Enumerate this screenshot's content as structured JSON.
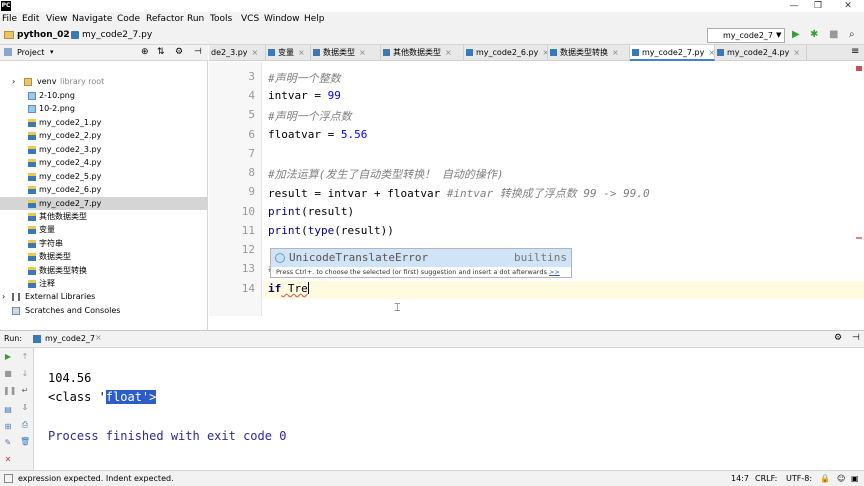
{
  "window": {
    "logo": "PC",
    "title_btns": [
      "—",
      "❐",
      "✕"
    ]
  },
  "menu": [
    "File",
    "Edit",
    "View",
    "Navigate",
    "Code",
    "Refactor",
    "Run",
    "Tools",
    "VCS",
    "Window",
    "Help"
  ],
  "breadcrumb": {
    "project": "python_02",
    "file": "my_code2_7.py"
  },
  "run_config": "my_code2_7",
  "project_panel": {
    "title": "Project"
  },
  "tree": [
    {
      "label": "venv",
      "suffix": "library root",
      "type": "folder",
      "depth": 0,
      "expand": "›"
    },
    {
      "label": "2-10.png",
      "type": "image",
      "depth": 1
    },
    {
      "label": "10-2.png",
      "type": "image",
      "depth": 1
    },
    {
      "label": "my_code2_1.py",
      "type": "py",
      "depth": 1
    },
    {
      "label": "my_code2_2.py",
      "type": "py",
      "depth": 1
    },
    {
      "label": "my_code2_3.py",
      "type": "py",
      "depth": 1
    },
    {
      "label": "my_code2_4.py",
      "type": "py",
      "depth": 1
    },
    {
      "label": "my_code2_5.py",
      "type": "py",
      "depth": 1
    },
    {
      "label": "my_code2_6.py",
      "type": "py",
      "depth": 1
    },
    {
      "label": "my_code2_7.py",
      "type": "py",
      "depth": 1,
      "selected": true
    },
    {
      "label": "其他数据类型",
      "type": "py",
      "depth": 1
    },
    {
      "label": "变量",
      "type": "py",
      "depth": 1
    },
    {
      "label": "字符串",
      "type": "py",
      "depth": 1
    },
    {
      "label": "数据类型",
      "type": "py",
      "depth": 1
    },
    {
      "label": "数据类型转换",
      "type": "py",
      "depth": 1
    },
    {
      "label": "注释",
      "type": "py",
      "depth": 1
    },
    {
      "label": "External Libraries",
      "type": "lib",
      "depth": 0,
      "expand": "›"
    },
    {
      "label": "Scratches and Consoles",
      "type": "scratch",
      "depth": 0
    }
  ],
  "tabs": [
    {
      "label": "de2_3.py",
      "active": false
    },
    {
      "label": "变量",
      "active": false
    },
    {
      "label": "数据类型",
      "active": false
    },
    {
      "label": "其他数据类型",
      "active": false
    },
    {
      "label": "my_code2_6.py",
      "active": false
    },
    {
      "label": "数据类型转换",
      "active": false
    },
    {
      "label": "my_code2_7.py",
      "active": true
    },
    {
      "label": "my_code2_4.py",
      "active": false
    }
  ],
  "line_numbers": [
    "3",
    "4",
    "5",
    "6",
    "7",
    "8",
    "9",
    "10",
    "11",
    "12",
    "13",
    "14"
  ],
  "code": {
    "l3": "#声明一个整数",
    "l4a": "intvar",
    "l4b": " = ",
    "l4c": "99",
    "l5": "#声明一个浮点数",
    "l6a": "floatvar",
    "l6b": " = ",
    "l6c": "5.56",
    "l8": "#加法运算(发生了自动类型转换！ 自动的操作)",
    "l9a": "result = intvar + floatvar ",
    "l9b": "#intvar 转换成了浮点数 99 -> 99.0",
    "l10a": "print",
    "l10b": "(result)",
    "l11a": "print",
    "l11b": "(",
    "l11c": "type",
    "l11d": "(result))",
    "l13": "#",
    "l14a": "if",
    "l14b": " Tre"
  },
  "completion": {
    "name": "UnicodeTranslateError",
    "module": "builtins",
    "hint": "Press Ctrl+. to choose the selected (or first) suggestion and insert a dot afterwards",
    "hint_link": ">>"
  },
  "run_panel": {
    "label": "Run:",
    "tab": "my_code2_7"
  },
  "console": {
    "line1": "104.56",
    "line2a": "<class '",
    "line2b": "float'",
    "line2c": ">",
    "line3": "Process finished with exit code 0"
  },
  "status": {
    "message": "expression expected. Indent expected.",
    "position": "14:7",
    "line_sep": "CRLF:",
    "encoding": "UTF-8:"
  },
  "colors": {
    "accent": "#4083c9",
    "keyword": "#000080",
    "comment": "#808080",
    "number": "#0000ff",
    "error_red": "#e06060"
  }
}
